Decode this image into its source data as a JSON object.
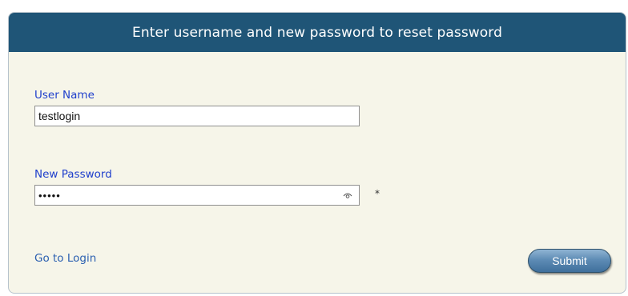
{
  "header": {
    "title": "Enter username and new password to reset password"
  },
  "form": {
    "username_label": "User Name",
    "username_value": "testlogin",
    "password_label": "New Password",
    "password_value": "•••••",
    "required_mark": "*"
  },
  "actions": {
    "go_to_login": "Go to Login",
    "submit": "Submit"
  },
  "icons": {
    "password_visibility": "eye-icon"
  },
  "colors": {
    "header_bg": "#1f5577",
    "panel_bg": "#f6f5e9",
    "label_color": "#1f3fcc",
    "link_color": "#2a5fb0",
    "button_color": "#5e8cb5"
  }
}
